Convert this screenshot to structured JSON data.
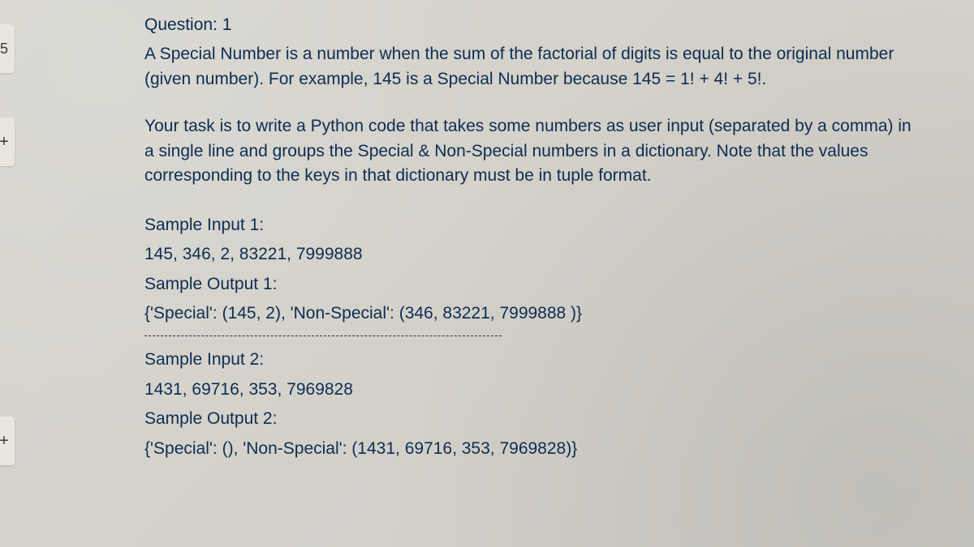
{
  "sidebar": {
    "tab_five": "5",
    "tab_plus_1": "+",
    "tab_plus_2": "+"
  },
  "question": {
    "title": "Question: 1",
    "desc_p1": "A Special Number is a number when the sum of the factorial of digits is equal to the original number (given number). For example, 145 is a Special Number because 145 = 1! + 4! + 5!.",
    "desc_p2": "Your task is to write a Python code that takes some numbers as user input (separated by a comma) in a single line and groups the Special & Non-Special numbers in a dictionary. Note that the values corresponding to the keys in that dictionary must be in tuple format.",
    "sample1": {
      "input_label": "Sample Input 1:",
      "input_value": "145, 346, 2, 83221, 7999888",
      "output_label": "Sample Output 1:",
      "output_value": "{'Special': (145, 2), 'Non-Special': (346, 83221, 7999888 )}"
    },
    "sample2": {
      "input_label": "Sample Input 2:",
      "input_value": "1431, 69716, 353, 7969828",
      "output_label": "Sample Output 2:",
      "output_value": "{'Special': (), 'Non-Special': (1431, 69716, 353, 7969828)}"
    }
  }
}
